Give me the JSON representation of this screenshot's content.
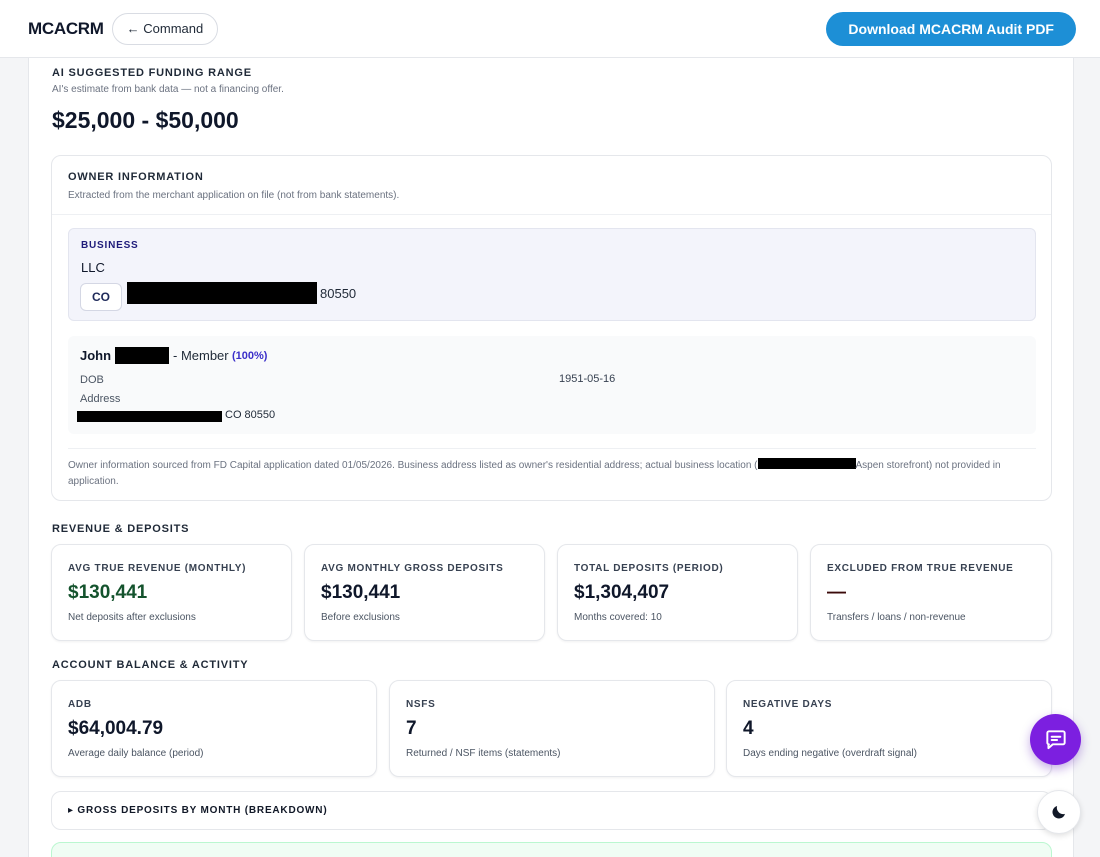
{
  "header": {
    "brand": "MCACRM",
    "command_label": "← Command",
    "download_label": "Download MCACRM Audit PDF"
  },
  "funding": {
    "title": "AI SUGGESTED FUNDING RANGE",
    "subtitle": "AI's estimate from bank data — not a financing offer.",
    "range": "$25,000 - $50,000"
  },
  "owner": {
    "title": "OWNER INFORMATION",
    "subtitle": "Extracted from the merchant application on file (not from bank statements).",
    "business": {
      "label": "BUSINESS",
      "name": "LLC",
      "state": "CO",
      "zip": "80550"
    },
    "person": {
      "first_name": "John",
      "role": "- Member",
      "ownership": "(100%)",
      "dob_label": "DOB",
      "dob_value": "1951-05-16",
      "address_label": "Address",
      "address_tail": "CO 80550"
    },
    "note_part1": "Owner information sourced from FD Capital application dated 01/05/2026. Business address listed as owner's residential address; actual business location (",
    "note_part2": "Aspen storefront) not provided in application."
  },
  "revenue": {
    "title": "REVENUE & DEPOSITS",
    "cards": [
      {
        "title": "AVG TRUE REVENUE (MONTHLY)",
        "value": "$130,441",
        "note": "Net deposits after exclusions"
      },
      {
        "title": "AVG MONTHLY GROSS DEPOSITS",
        "value": "$130,441",
        "note": "Before exclusions"
      },
      {
        "title": "TOTAL DEPOSITS (PERIOD)",
        "value": "$1,304,407",
        "note": "Months covered: 10"
      },
      {
        "title": "EXCLUDED FROM TRUE REVENUE",
        "value": "—",
        "note": "Transfers / loans / non-revenue"
      }
    ]
  },
  "balance": {
    "title": "ACCOUNT BALANCE & ACTIVITY",
    "cards": [
      {
        "title": "ADB",
        "value": "$64,004.79",
        "note": "Average daily balance (period)"
      },
      {
        "title": "NSFS",
        "value": "7",
        "note": "Returned / NSF items (statements)"
      },
      {
        "title": "NEGATIVE DAYS",
        "value": "4",
        "note": "Days ending negative (overdraft signal)"
      }
    ]
  },
  "breakdown": {
    "label": "▸ GROSS DEPOSITS BY MONTH (BREAKDOWN)"
  },
  "icons": {
    "chat": "chat-icon",
    "theme": "moon-icon"
  },
  "colors": {
    "accent": "#1d8fd6",
    "chat_fab": "#7c1fe0",
    "revenue_green": "#14532d"
  }
}
